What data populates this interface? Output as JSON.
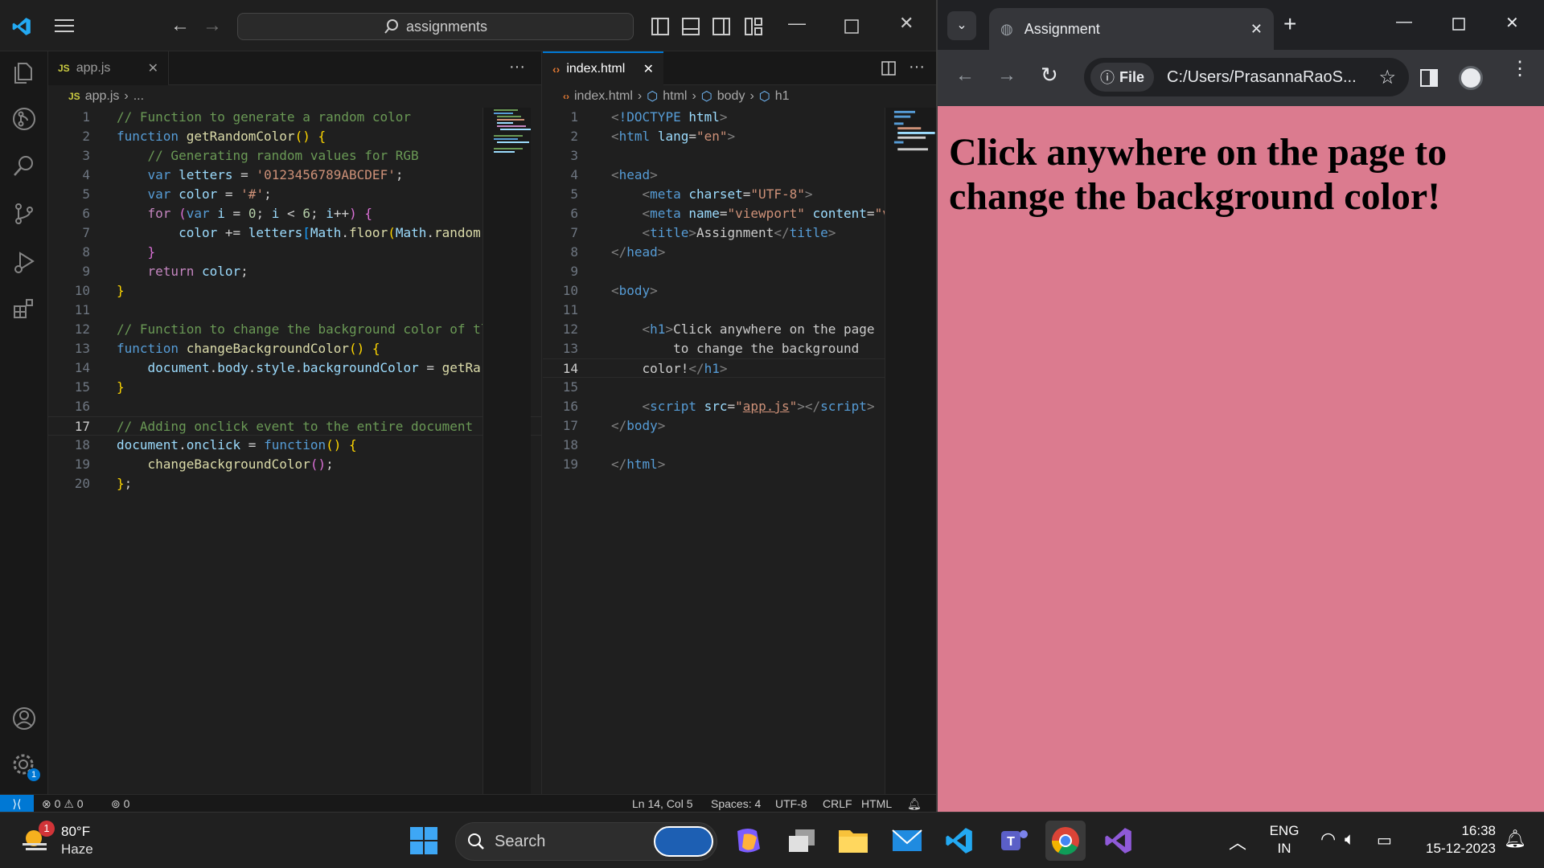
{
  "vscode": {
    "search_text": "assignments",
    "editor1": {
      "tab_label": "app.js",
      "breadcrumb": [
        "app.js",
        "..."
      ],
      "lines": [
        "1",
        "2",
        "3",
        "4",
        "5",
        "6",
        "7",
        "8",
        "9",
        "10",
        "11",
        "12",
        "13",
        "14",
        "15",
        "16",
        "17",
        "18",
        "19",
        "20"
      ],
      "current_line": 17
    },
    "editor2": {
      "tab_label": "index.html",
      "breadcrumb": [
        "index.html",
        "html",
        "body",
        "h1"
      ],
      "current_line": 14
    },
    "statusbar": {
      "errors": "0",
      "warnings": "0",
      "ports": "0",
      "position": "Ln 14, Col 5",
      "spaces": "Spaces: 4",
      "encoding": "UTF-8",
      "eol": "CRLF",
      "language": "HTML"
    },
    "settings_badge": "1"
  },
  "chrome": {
    "tab_title": "Assignment",
    "site_chip": "File",
    "address": "C:/Users/PrasannaRaoS...",
    "page_heading": "Click anywhere on the page to change the background color!",
    "page_background": "#db7b8f"
  },
  "taskbar": {
    "weather_temp": "80°F",
    "weather_desc": "Haze",
    "weather_badge": "1",
    "search_placeholder": "Search",
    "lang_top": "ENG",
    "lang_bottom": "IN",
    "time": "16:38",
    "date": "15-12-2023"
  },
  "colors": {
    "vscode_accent": "#0078d4",
    "page_pink": "#db7b8f"
  }
}
